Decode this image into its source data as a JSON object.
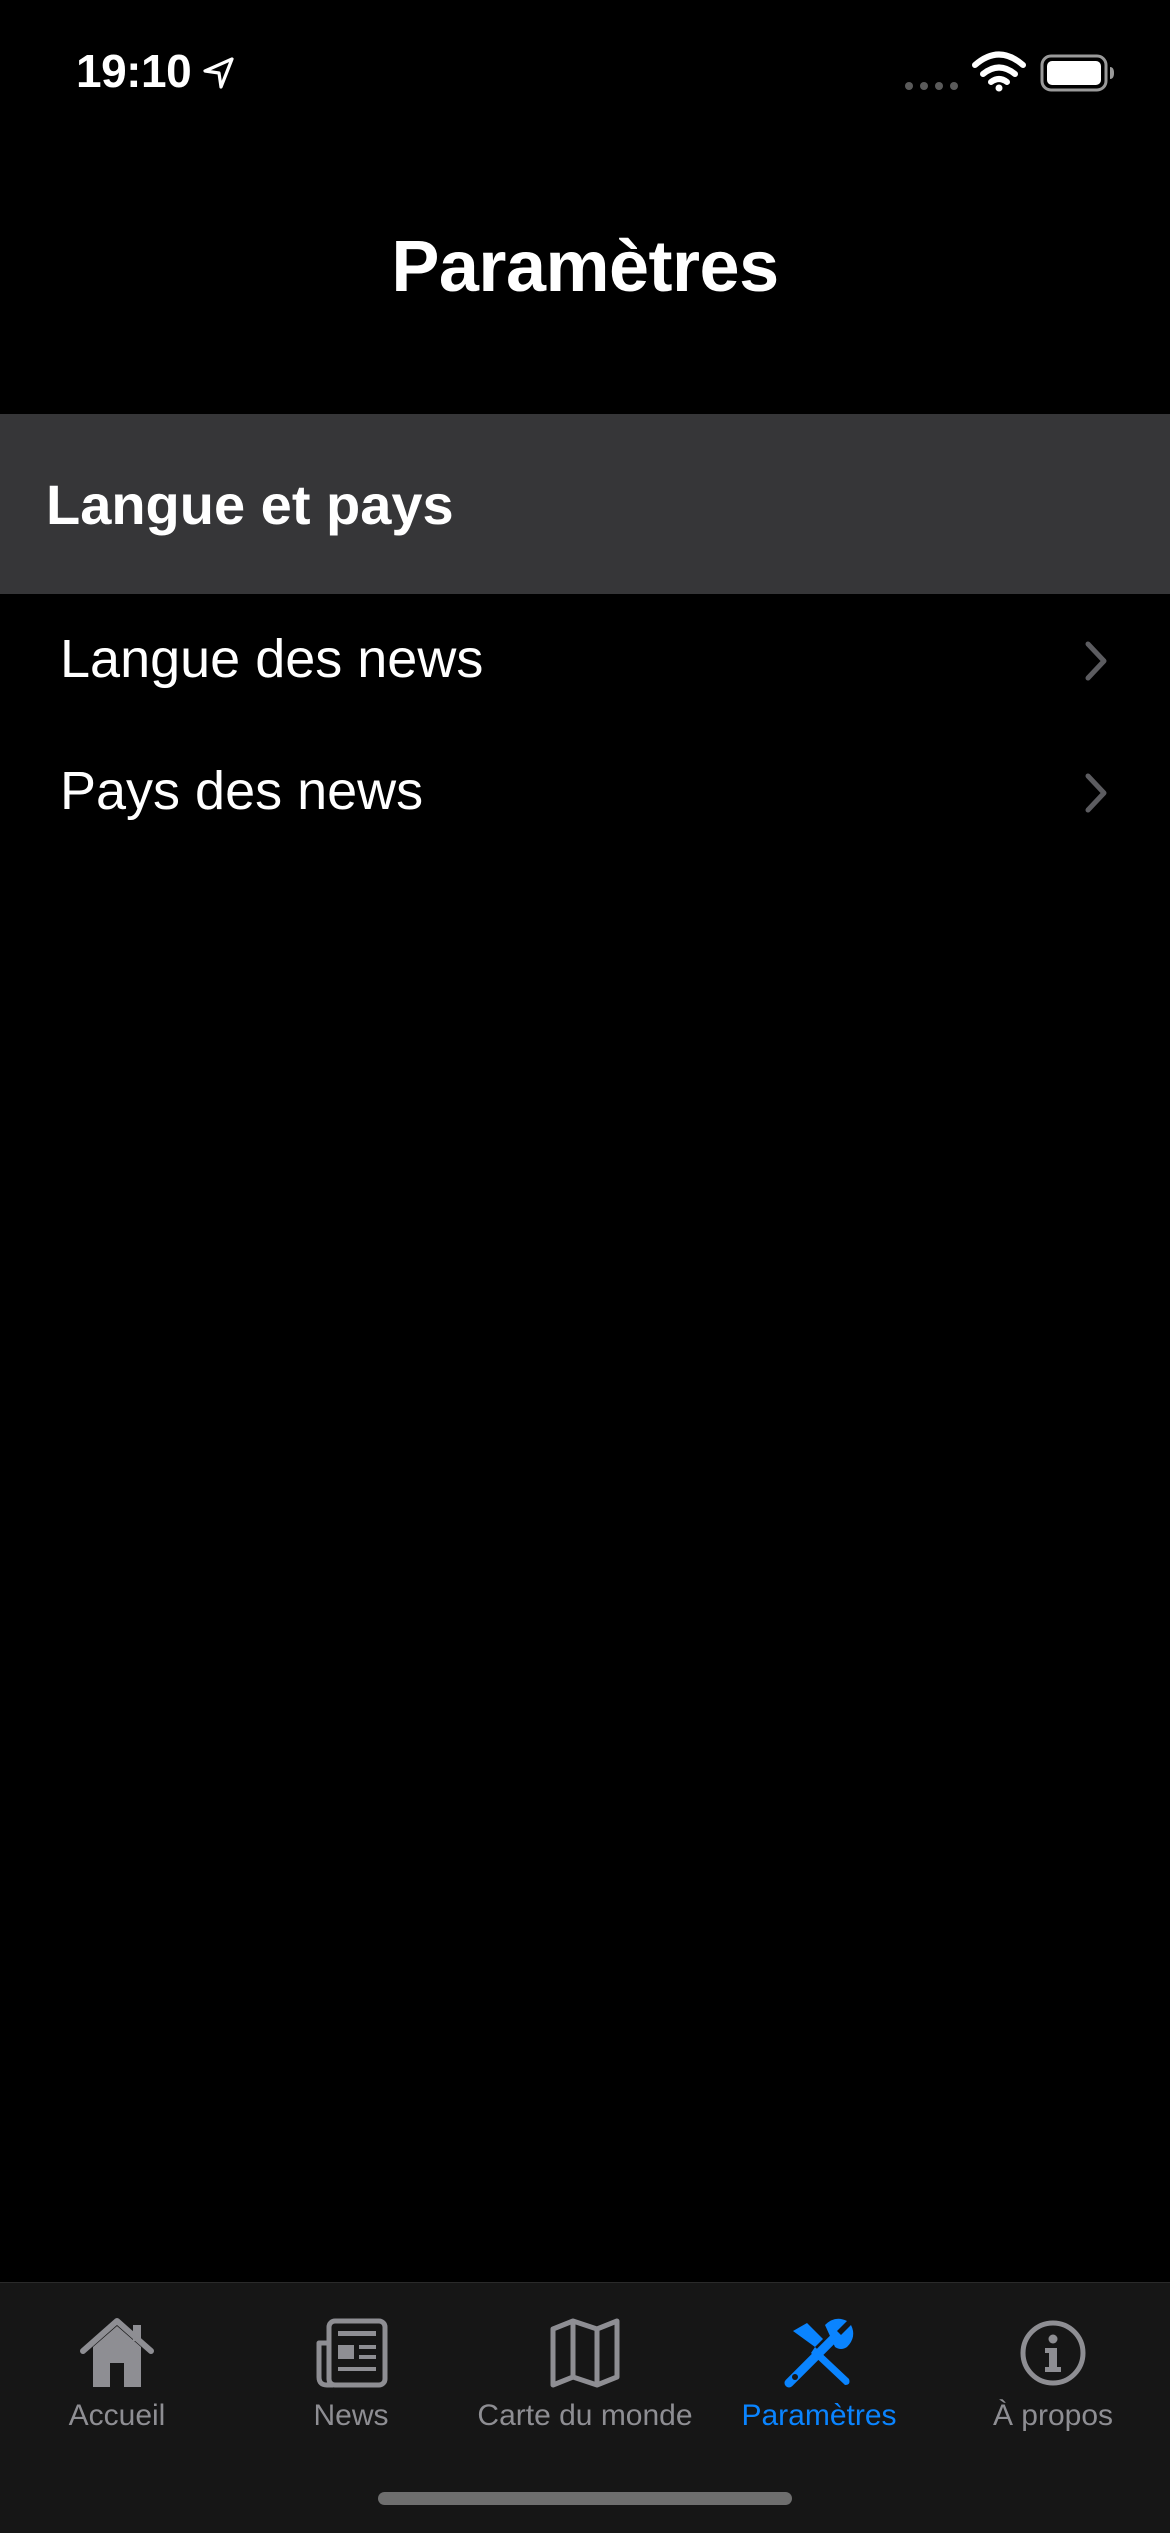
{
  "status_bar": {
    "time": "19:10"
  },
  "navigation": {
    "title": "Paramètres"
  },
  "section": {
    "header": "Langue et pays",
    "rows": [
      {
        "label": "Langue des news",
        "icon": "chevron-right-icon"
      },
      {
        "label": "Pays des news",
        "icon": "chevron-right-icon"
      }
    ]
  },
  "tab_bar": {
    "tabs": [
      {
        "label": "Accueil",
        "icon": "house-icon",
        "active": false
      },
      {
        "label": "News",
        "icon": "newspaper-icon",
        "active": false
      },
      {
        "label": "Carte du monde",
        "icon": "map-icon",
        "active": false
      },
      {
        "label": "Paramètres",
        "icon": "tools-icon",
        "active": true
      },
      {
        "label": "À propos",
        "icon": "info-icon",
        "active": false
      }
    ]
  },
  "colors": {
    "background": "#000000",
    "section_header_bg": "#363638",
    "tab_bar_bg": "#161616",
    "accent": "#0a84ff",
    "inactive": "#8e8e93"
  }
}
